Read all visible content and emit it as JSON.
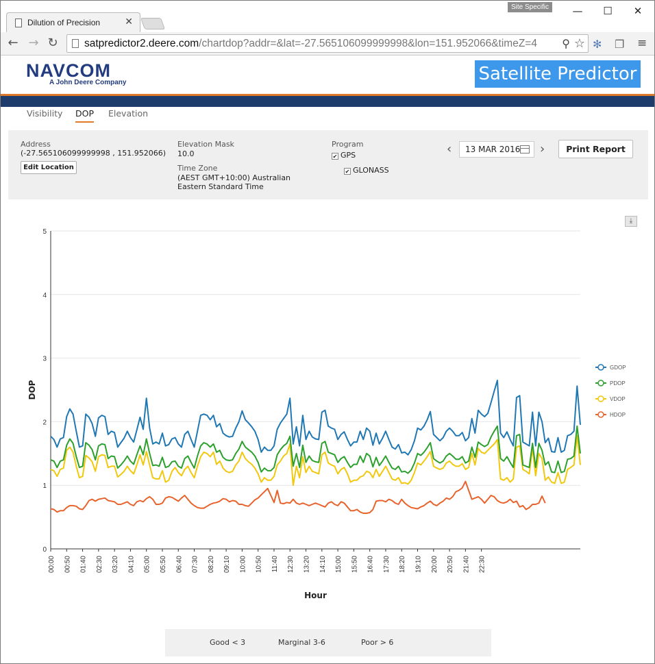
{
  "browser": {
    "tab_title": "Dilution of Precision",
    "tab_close": "✕",
    "site_specific": "Site Specific",
    "window_minimize": "—",
    "window_maximize": "☐",
    "window_close": "✕",
    "url_host": "satpredictor2.deere.com",
    "url_path": "/chartdop?addr=&lat=-27.565106099999998&lon=151.952066&timeZ=4",
    "icons": [
      "back-icon",
      "forward-icon",
      "reload-icon",
      "page-icon",
      "zoom-icon",
      "star-icon",
      "extension-icon",
      "copy-icon",
      "menu-icon"
    ]
  },
  "header": {
    "logo_brand": "NAVCOM",
    "logo_tagline": "A John Deere Company",
    "app_title": "Satellite Predictor"
  },
  "nav": {
    "tabs": [
      {
        "label": "Visibility",
        "active": false
      },
      {
        "label": "DOP",
        "active": true
      },
      {
        "label": "Elevation",
        "active": false
      }
    ]
  },
  "settings": {
    "address_label": "Address",
    "address_value": "(-27.565106099999998 , 151.952066)",
    "edit_location": "Edit Location",
    "elevation_label": "Elevation Mask",
    "elevation_value": "10.0",
    "timezone_label": "Time Zone",
    "timezone_value": "(AEST GMT+10:00) Australian Eastern Standard Time",
    "program_label": "Program",
    "gps_label": "GPS",
    "gps_checked": true,
    "glonass_label": "GLONASS",
    "glonass_checked": true,
    "date": "13 MAR 2016",
    "print_report": "Print Report"
  },
  "chart_data": {
    "type": "line",
    "title": "",
    "xlabel": "Hour",
    "ylabel": "DOP",
    "ylim": [
      0,
      5
    ],
    "yticks": [
      "0",
      "1",
      "2",
      "3",
      "4",
      "5"
    ],
    "xticks": [
      "00:00",
      "00:50",
      "01:40",
      "02:30",
      "03:20",
      "04:10",
      "05:00",
      "05:50",
      "06:40",
      "07:30",
      "08:20",
      "09:10",
      "10:00",
      "10:50",
      "11:40",
      "12:30",
      "13:20",
      "14:10",
      "15:00",
      "15:50",
      "16:40",
      "17:30",
      "18:20",
      "19:10",
      "20:00",
      "20:50",
      "21:40",
      "22:30"
    ],
    "grid": true,
    "legend_position": "right",
    "x_interval_minutes": 10,
    "series": [
      {
        "name": "GDOP",
        "color": "#1f77b4",
        "values": [
          1.77,
          1.72,
          1.6,
          1.73,
          1.75,
          2.08,
          2.2,
          2.12,
          1.85,
          1.6,
          1.62,
          2.12,
          2.07,
          1.97,
          1.77,
          2.06,
          2.1,
          2.08,
          1.8,
          1.85,
          1.83,
          1.6,
          1.67,
          1.74,
          1.85,
          1.75,
          1.68,
          1.87,
          2.07,
          1.88,
          2.37,
          1.9,
          1.65,
          1.68,
          1.65,
          1.82,
          1.62,
          1.64,
          1.73,
          1.75,
          1.65,
          1.6,
          1.8,
          1.85,
          1.72,
          1.6,
          1.85,
          2.1,
          2.12,
          2.1,
          2.03,
          2.1,
          1.92,
          1.97,
          1.82,
          1.78,
          1.76,
          1.77,
          1.9,
          2.0,
          2.17,
          2.03,
          1.98,
          1.92,
          1.85,
          1.72,
          1.52,
          1.6,
          1.55,
          1.55,
          1.62,
          1.88,
          1.98,
          2.05,
          2.12,
          2.37,
          1.65,
          1.92,
          1.62,
          2.1,
          1.72,
          1.85,
          1.76,
          1.73,
          1.72,
          2.15,
          2.18,
          1.93,
          1.9,
          1.88,
          1.72,
          1.8,
          1.84,
          1.72,
          1.62,
          1.68,
          1.68,
          1.85,
          1.72,
          1.9,
          1.85,
          1.63,
          1.82,
          1.65,
          1.74,
          1.85,
          1.72,
          1.6,
          1.57,
          1.64,
          1.51,
          1.52,
          1.48,
          1.56,
          1.7,
          1.9,
          1.87,
          1.93,
          2.03,
          2.16,
          1.8,
          1.75,
          1.7,
          1.75,
          1.85,
          1.9,
          1.85,
          1.78,
          1.78,
          1.83,
          1.7,
          1.75,
          2.05,
          1.82,
          2.18,
          2.12,
          2.08,
          2.13,
          2.3,
          2.48,
          2.65,
          1.82,
          1.75,
          1.84,
          1.72,
          1.62,
          2.38,
          2.41,
          1.68,
          1.65,
          1.62,
          2.15,
          1.62,
          2.15,
          2.0,
          1.67,
          1.74,
          1.53,
          1.52,
          1.75,
          1.52,
          1.55,
          1.78,
          1.8,
          1.85,
          2.56,
          1.95
        ]
      },
      {
        "name": "PDOP",
        "color": "#2ca02c",
        "values": [
          1.4,
          1.38,
          1.28,
          1.38,
          1.4,
          1.63,
          1.73,
          1.66,
          1.45,
          1.28,
          1.3,
          1.67,
          1.63,
          1.56,
          1.4,
          1.62,
          1.65,
          1.64,
          1.42,
          1.46,
          1.45,
          1.27,
          1.32,
          1.38,
          1.46,
          1.38,
          1.33,
          1.48,
          1.62,
          1.48,
          1.73,
          1.5,
          1.31,
          1.32,
          1.3,
          1.44,
          1.28,
          1.3,
          1.37,
          1.38,
          1.3,
          1.27,
          1.42,
          1.46,
          1.36,
          1.27,
          1.46,
          1.62,
          1.67,
          1.65,
          1.6,
          1.65,
          1.52,
          1.55,
          1.44,
          1.4,
          1.39,
          1.4,
          1.5,
          1.57,
          1.69,
          1.6,
          1.56,
          1.52,
          1.46,
          1.36,
          1.21,
          1.27,
          1.23,
          1.23,
          1.28,
          1.48,
          1.56,
          1.62,
          1.66,
          1.77,
          1.3,
          1.5,
          1.28,
          1.63,
          1.36,
          1.46,
          1.39,
          1.37,
          1.36,
          1.66,
          1.69,
          1.52,
          1.5,
          1.48,
          1.36,
          1.42,
          1.45,
          1.36,
          1.28,
          1.33,
          1.33,
          1.46,
          1.36,
          1.5,
          1.46,
          1.29,
          1.44,
          1.31,
          1.38,
          1.46,
          1.36,
          1.27,
          1.25,
          1.3,
          1.21,
          1.22,
          1.19,
          1.24,
          1.35,
          1.5,
          1.47,
          1.52,
          1.59,
          1.67,
          1.42,
          1.38,
          1.35,
          1.38,
          1.46,
          1.5,
          1.46,
          1.41,
          1.41,
          1.45,
          1.35,
          1.38,
          1.6,
          1.44,
          1.68,
          1.64,
          1.61,
          1.64,
          1.76,
          1.85,
          1.93,
          1.42,
          1.38,
          1.45,
          1.36,
          1.28,
          1.78,
          1.8,
          1.32,
          1.3,
          1.28,
          1.66,
          1.28,
          1.66,
          1.55,
          1.32,
          1.37,
          1.21,
          1.2,
          1.38,
          1.2,
          1.22,
          1.41,
          1.42,
          1.46,
          1.93,
          1.5
        ]
      },
      {
        "name": "VDOP",
        "color": "#f2c80f",
        "values": [
          1.25,
          1.23,
          1.14,
          1.25,
          1.27,
          1.55,
          1.6,
          1.52,
          1.3,
          1.12,
          1.14,
          1.47,
          1.43,
          1.37,
          1.22,
          1.45,
          1.48,
          1.47,
          1.28,
          1.3,
          1.3,
          1.13,
          1.17,
          1.22,
          1.3,
          1.23,
          1.18,
          1.32,
          1.48,
          1.32,
          1.53,
          1.32,
          1.12,
          1.1,
          1.1,
          1.23,
          1.05,
          1.08,
          1.22,
          1.28,
          1.2,
          1.15,
          1.25,
          1.3,
          1.2,
          1.12,
          1.3,
          1.45,
          1.52,
          1.5,
          1.45,
          1.52,
          1.33,
          1.38,
          1.27,
          1.22,
          1.2,
          1.22,
          1.32,
          1.38,
          1.52,
          1.42,
          1.37,
          1.33,
          1.27,
          1.18,
          1.05,
          1.12,
          1.08,
          1.08,
          1.14,
          1.32,
          1.38,
          1.46,
          1.5,
          1.65,
          1.0,
          1.3,
          1.12,
          1.45,
          1.2,
          1.3,
          1.22,
          1.2,
          1.18,
          1.48,
          1.52,
          1.35,
          1.32,
          1.3,
          1.18,
          1.25,
          1.28,
          1.18,
          1.05,
          1.08,
          1.08,
          1.13,
          1.15,
          1.22,
          1.2,
          1.12,
          1.25,
          1.14,
          1.22,
          1.3,
          1.2,
          1.1,
          1.08,
          1.12,
          1.03,
          1.04,
          1.02,
          1.08,
          1.2,
          1.35,
          1.32,
          1.38,
          1.45,
          1.53,
          1.3,
          1.27,
          1.25,
          1.27,
          1.35,
          1.38,
          1.33,
          1.3,
          1.3,
          1.34,
          1.25,
          1.28,
          1.5,
          1.32,
          1.58,
          1.52,
          1.5,
          1.55,
          1.6,
          1.65,
          1.72,
          1.1,
          1.08,
          1.12,
          1.05,
          1.1,
          1.6,
          1.62,
          1.25,
          1.22,
          1.18,
          1.58,
          1.15,
          1.5,
          1.42,
          1.08,
          1.13,
          1.05,
          1.03,
          1.2,
          1.03,
          1.05,
          1.25,
          1.28,
          1.32,
          1.78,
          1.32
        ]
      },
      {
        "name": "HDOP",
        "color": "#e8632b",
        "values": [
          0.63,
          0.62,
          0.58,
          0.6,
          0.6,
          0.65,
          0.68,
          0.68,
          0.67,
          0.63,
          0.62,
          0.68,
          0.76,
          0.78,
          0.75,
          0.78,
          0.79,
          0.8,
          0.76,
          0.75,
          0.74,
          0.7,
          0.7,
          0.72,
          0.74,
          0.7,
          0.68,
          0.74,
          0.76,
          0.74,
          0.79,
          0.82,
          0.78,
          0.7,
          0.7,
          0.72,
          0.8,
          0.82,
          0.81,
          0.78,
          0.75,
          0.8,
          0.84,
          0.78,
          0.72,
          0.68,
          0.65,
          0.64,
          0.64,
          0.67,
          0.7,
          0.72,
          0.73,
          0.75,
          0.79,
          0.78,
          0.74,
          0.76,
          0.75,
          0.7,
          0.7,
          0.68,
          0.67,
          0.72,
          0.77,
          0.8,
          0.85,
          0.9,
          0.95,
          0.84,
          0.73,
          0.92,
          0.72,
          0.71,
          0.73,
          0.72,
          0.78,
          0.72,
          0.7,
          0.72,
          0.7,
          0.68,
          0.7,
          0.72,
          0.7,
          0.68,
          0.66,
          0.72,
          0.74,
          0.7,
          0.68,
          0.74,
          0.72,
          0.66,
          0.6,
          0.6,
          0.62,
          0.58,
          0.56,
          0.56,
          0.57,
          0.62,
          0.75,
          0.76,
          0.76,
          0.74,
          0.78,
          0.76,
          0.72,
          0.7,
          0.78,
          0.72,
          0.68,
          0.65,
          0.64,
          0.63,
          0.66,
          0.68,
          0.72,
          0.75,
          0.7,
          0.68,
          0.72,
          0.75,
          0.8,
          0.78,
          0.82,
          0.9,
          0.92,
          0.96,
          1.06,
          0.92,
          0.78,
          0.8,
          0.82,
          0.78,
          0.72,
          0.78,
          0.84,
          0.82,
          0.76,
          0.73,
          0.72,
          0.74,
          0.78,
          0.73,
          0.75,
          0.66,
          0.68,
          0.62,
          0.65,
          0.7,
          0.7,
          0.72,
          0.83,
          0.72
        ]
      }
    ]
  },
  "quality_legend": {
    "good": "Good < 3",
    "marginal": "Marginal 3-6",
    "poor": "Poor > 6"
  }
}
